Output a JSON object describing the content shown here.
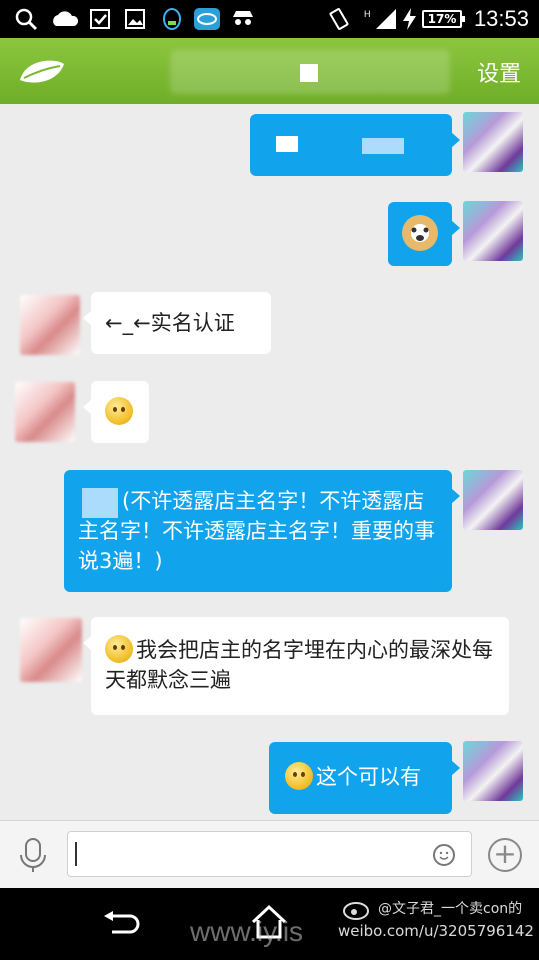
{
  "status_bar": {
    "time": "13:53",
    "battery": "17%",
    "icons": [
      "search-icon",
      "cloud-icon",
      "checkbox-icon",
      "image-icon",
      "qq-icon",
      "qq-browser-icon",
      "incognito-icon",
      "vibrate-icon",
      "signal-icon",
      "charging-icon"
    ]
  },
  "header": {
    "title": "",
    "settings_label": "设置",
    "logo_icon": "leaf-icon"
  },
  "messages": [
    {
      "sender": "me",
      "text": "",
      "redacted": true
    },
    {
      "sender": "me",
      "text": "",
      "sticker": "doge-icon"
    },
    {
      "sender": "other",
      "text": "←_←实名认证"
    },
    {
      "sender": "other",
      "text": "",
      "emoji": "thinking-emoji"
    },
    {
      "sender": "me",
      "text": "(不许透露店主名字！不许透露店主名字！不许透露店主名字！重要的事说3遍！)"
    },
    {
      "sender": "other",
      "text": "我会把店主的名字埋在内心的最深处每天都默念三遍",
      "emoji": "smile-emoji"
    },
    {
      "sender": "me",
      "text": "这个可以有",
      "emoji": "smile-emoji"
    }
  ],
  "input_bar": {
    "value": "",
    "mic_icon": "microphone-icon",
    "emoji_icon": "smiley-icon",
    "more_icon": "plus-icon"
  },
  "nav_bar": {
    "back_icon": "back-icon",
    "home_icon": "home-icon"
  },
  "watermark": {
    "site": "www.iy.is",
    "user": "@文子君_一个卖con的",
    "url": "weibo.com/u/3205796142"
  },
  "colors": {
    "accent_green": "#7ab831",
    "bubble_blue": "#11a4ec",
    "background": "#ececec"
  }
}
